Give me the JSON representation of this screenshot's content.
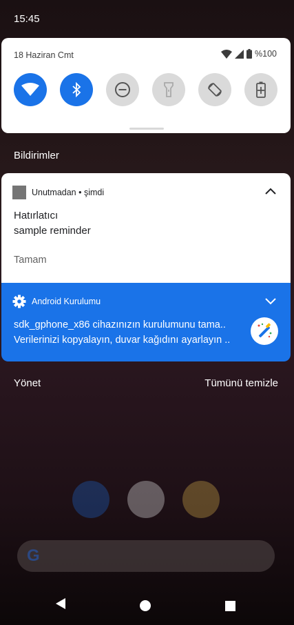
{
  "status_bar": {
    "time": "15:45"
  },
  "quick_settings": {
    "date": "18 Haziran Cmt",
    "battery": "%100",
    "tiles": [
      {
        "name": "wifi",
        "state": "on"
      },
      {
        "name": "bluetooth",
        "state": "on"
      },
      {
        "name": "do-not-disturb",
        "state": "off"
      },
      {
        "name": "flashlight",
        "state": "off"
      },
      {
        "name": "auto-rotate",
        "state": "off"
      },
      {
        "name": "battery-saver",
        "state": "off"
      }
    ]
  },
  "notifications_title": "Bildirimler",
  "notification1": {
    "app": "Unutmadan • şimdi",
    "title": "Hatırlatıcı",
    "text": "sample reminder",
    "action": "Tamam"
  },
  "notification2": {
    "app": "Android Kurulumu",
    "line1": "sdk_gphone_x86 cihazınızın kurulumunu tama..",
    "line2": "Verilerinizi kopyalayın, duvar kağıdını ayarlayın .."
  },
  "footer": {
    "manage": "Yönet",
    "clear_all": "Tümünü temizle"
  },
  "colors": {
    "accent": "#1a73e8",
    "tile_off": "#dadada"
  }
}
